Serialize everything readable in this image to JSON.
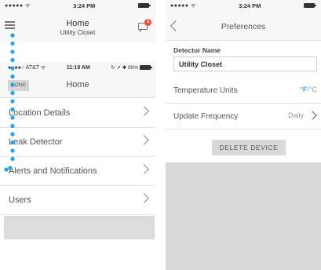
{
  "left": {
    "status": {
      "dots": "●●●●● ",
      "wifi": "ᯤ",
      "time": "3:24 PM"
    },
    "nav": {
      "title": "Home",
      "subtitle": "Utility Closet",
      "badge": "3"
    },
    "inner_status": {
      "carrier": "●●●●○ AT&T ",
      "wifi": "ᯤ",
      "time": "11:19 AM",
      "right": "↻ ➚ ✱ 99%"
    },
    "inner_nav": {
      "done": "DONE",
      "title": "Home"
    },
    "menu": [
      {
        "label": "Location Details"
      },
      {
        "label": "Leak Detector"
      },
      {
        "label": "Alerts and Notifications"
      },
      {
        "label": "Users"
      }
    ]
  },
  "right": {
    "status": {
      "dots": "●●●●● ",
      "wifi": "ᯤ",
      "time": "3:24 PM"
    },
    "nav": {
      "title": "Preferences"
    },
    "detector_label": "Detector Name",
    "detector_value": "Utility Closet",
    "temperature": {
      "label": "Temperature Units",
      "f": "°F",
      "sep": "/",
      "c": "°C"
    },
    "update": {
      "label": "Update Frequency",
      "value": "Daily"
    },
    "delete_label": "DELETE DEVICE"
  },
  "colors": {
    "accent": "#3aa3e3",
    "badge": "#e94d2c",
    "path_dots": "#29a3e0"
  }
}
